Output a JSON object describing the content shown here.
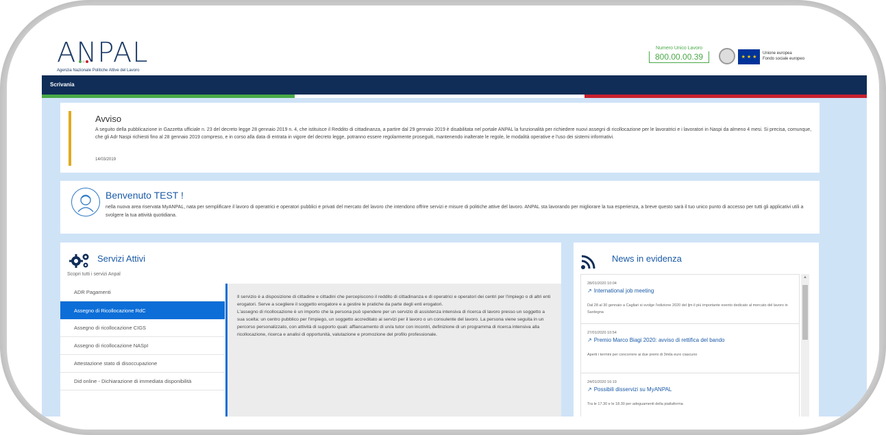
{
  "header": {
    "logo_text": "ANPAL",
    "logo_subtitle": "Agenzia Nazionale Politiche Attive del Lavoro",
    "phone_label": "Numero Unico Lavoro",
    "phone_number": "800.00.00.39",
    "eu_line1": "Unione europea",
    "eu_line2": "Fondo sociale europeo"
  },
  "nav": {
    "label": "Scrivania"
  },
  "avviso": {
    "title": "Avviso",
    "body": "A seguito della pubblicazione in Gazzetta ufficiale n. 23 del decreto legge 28 gennaio 2019 n. 4, che istituisce il Reddito di cittadinanza, a partire dal 29 gennaio 2019 è disabilitata nel portale ANPAL la funzionalità per richiedere nuovi assegni di ricollocazione per le lavoratrici e i lavoratori in Naspi da almeno 4 mesi. Si precisa, comunque, che gli Adr Naspi richiesti fino al 28 gennaio 2019 compreso, e in corso alla data di entrata in vigore del decreto legge, potranno essere regolarmente proseguiti, mantenendo inalterate le regole, le modalità operative e l'uso dei sistemi informativi.",
    "date": "14/03/2019"
  },
  "welcome": {
    "title": "Benvenuto TEST !",
    "body": "nella nuova area riservata MyANPAL, nata per semplificare il lavoro di operatrici e operatori pubblici e privati del mercato del lavoro che intendono offrire servizi e misure di politiche attive del lavoro. ANPAL sta lavorando per migliorare la tua esperienza, a breve questo sarà il tuo unico punto di accesso per tutti gli applicativi utili a svolgere la tua attività quotidiana."
  },
  "servizi": {
    "title": "Servizi Attivi",
    "subtitle": "Scopri tutti i servizi Anpal",
    "items": [
      {
        "label": "ADR Pagamenti"
      },
      {
        "label": "Assegno di Ricollocazione RdC"
      },
      {
        "label": "Assegno di ricollocazione CIGS"
      },
      {
        "label": "Assegno di ricollocazione NASpI"
      },
      {
        "label": "Attestazione stato di disoccupazione"
      },
      {
        "label": "Did online - Dichiarazione di immediata disponibilità"
      }
    ],
    "active_index": 1,
    "description_p1": "Il servizio è a disposizione di cittadine e cittadini che percepiscono il reddito di cittadinanza e di operatrici e operatori dei centri per l'impiego o di altri enti erogatori. Serve a scegliere il soggetto erogatore e a gestire le pratiche da parte degli enti erogatori.",
    "description_p2": "L'assegno di ricollocazione è un importo che la persona può spendere per un servizio di assistenza intensiva di ricerca di lavoro presso un soggetto a sua scelta: un centro pubblico per l'impiego, un soggetto accreditato ai servizi per il lavoro o un consulente del lavoro. La persona viene seguita in un percorso personalizzato, con attività di supporto quali: affiancamento di un/a tutor con incontri, definizione di un programma di ricerca intensiva alla ricollocazione, ricerca e analisi di opportunità, valutazione e promozione del profilo professionale."
  },
  "news": {
    "title": "News in evidenza",
    "items": [
      {
        "date": "28/01/2020 10:04",
        "headline": "International job meeting",
        "summary": "Dal 28 al 30 gennaio a Cagliari si svolge l'edizione 2020 del ljm il più importante evento dedicato al mercato del lavoro in Sardegna"
      },
      {
        "date": "27/01/2020 10:54",
        "headline": "Premio Marco Biagi 2020: avviso di rettifica del bando",
        "summary": "Aperti i termini per concorrere ai due premi di 3mila euro ciascuno"
      },
      {
        "date": "24/01/2020 16:19",
        "headline": "Possibili disservizi su MyANPAL",
        "summary": "Tra le 17.30 e le 18.30 per adeguamenti della piattaforma"
      }
    ]
  },
  "colors": {
    "navy": "#0f2d57",
    "accent_blue": "#0d6ed8",
    "title_blue": "#1a5aa6",
    "avviso_bar": "#e0a920",
    "green": "#48a947",
    "red": "#c8202f",
    "background": "#cfe3f7"
  }
}
